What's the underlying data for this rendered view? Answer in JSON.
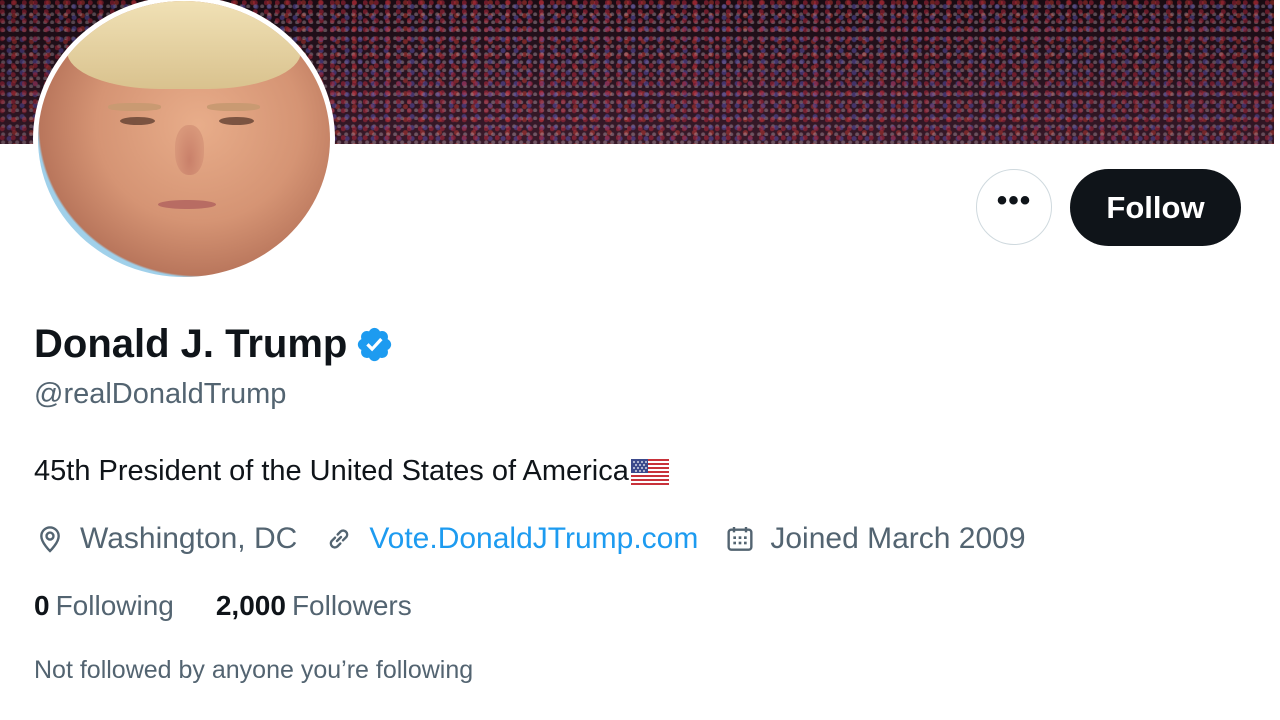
{
  "profile": {
    "name": "Donald J. Trump",
    "handle": "@realDonaldTrump",
    "bio": "45th President of the United States of America",
    "verified": true
  },
  "actions": {
    "more_label": "•••",
    "follow_label": "Follow"
  },
  "meta": {
    "location": "Washington, DC",
    "website": "Vote.DonaldJTrump.com",
    "joined": "Joined March 2009"
  },
  "stats": {
    "following_count": "0",
    "following_label": "Following",
    "followers_count": "2,000",
    "followers_label": "Followers"
  },
  "followed_by_note": "Not followed by anyone you’re following",
  "icons": [
    "verified-badge-icon",
    "us-flag-icon",
    "location-pin-icon",
    "link-icon",
    "calendar-icon",
    "more-dots-icon"
  ],
  "colors": {
    "primary_text": "#0f1419",
    "secondary_text": "#536471",
    "link": "#1d9bf0",
    "follow_button_bg": "#0f1419",
    "verified_badge": "#1d9bf0"
  }
}
